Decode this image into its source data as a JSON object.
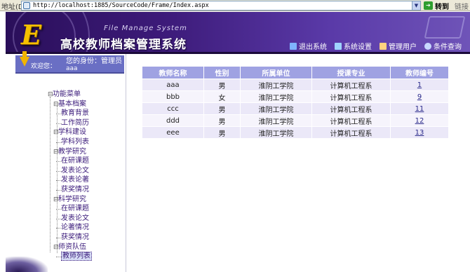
{
  "browser": {
    "address_label": "地址(D)",
    "url": "http://localhost:1885/SourceCode/Frame/Index.aspx",
    "go_label": "转到",
    "links_label": "链接"
  },
  "banner": {
    "logo_letter": "E",
    "subtitle": "File Manage System",
    "title": "高校教师档案管理系统",
    "nav": [
      {
        "label": "退出系统",
        "icon": "logout-icon",
        "color": "#7fb3ff"
      },
      {
        "label": "系统设置",
        "icon": "settings-icon",
        "color": "#9fd4ff"
      },
      {
        "label": "管理用户",
        "icon": "users-icon",
        "color": "#ffd27f"
      },
      {
        "label": "条件查询",
        "icon": "search-icon",
        "color": "#c8d8ff"
      }
    ]
  },
  "sidebar": {
    "welcome": "欢迎您：",
    "username": "aaa",
    "identity_label": "您的身份：管理员",
    "menu": [
      {
        "label": "功能菜单",
        "level": 0,
        "toggle": "⊟"
      },
      {
        "label": "基本档案",
        "level": 1,
        "toggle": "⊟"
      },
      {
        "label": "教育背景",
        "level": 2
      },
      {
        "label": "工作简历",
        "level": 2
      },
      {
        "label": "学科建设",
        "level": 1,
        "toggle": "⊟"
      },
      {
        "label": "学科列表",
        "level": 2
      },
      {
        "label": "教学研究",
        "level": 1,
        "toggle": "⊟"
      },
      {
        "label": "在研课题",
        "level": 2
      },
      {
        "label": "发表论文",
        "level": 2
      },
      {
        "label": "发表论著",
        "level": 2
      },
      {
        "label": "获奖情况",
        "level": 2
      },
      {
        "label": "科学研究",
        "level": 1,
        "toggle": "⊟"
      },
      {
        "label": "在研课题",
        "level": 2
      },
      {
        "label": "发表论文",
        "level": 2
      },
      {
        "label": "论著情况",
        "level": 2
      },
      {
        "label": "获奖情况",
        "level": 2
      },
      {
        "label": "师资队伍",
        "level": 1,
        "toggle": "⊟"
      },
      {
        "label": "教师列表",
        "level": 2,
        "selected": true
      }
    ]
  },
  "table": {
    "headers": [
      "教师名称",
      "性别",
      "所属单位",
      "授课专业",
      "教师编号"
    ],
    "rows": [
      [
        "aaa",
        "男",
        "淮阴工学院",
        "计算机工程系",
        "1"
      ],
      [
        "bbb",
        "女",
        "淮阴工学院",
        "计算机工程系",
        "9"
      ],
      [
        "ccc",
        "男",
        "淮阴工学院",
        "计算机工程系",
        "11"
      ],
      [
        "ddd",
        "男",
        "淮阴工学院",
        "计算机工程系",
        "12"
      ],
      [
        "eee",
        "男",
        "淮阴工学院",
        "计算机工程系",
        "13"
      ]
    ]
  }
}
